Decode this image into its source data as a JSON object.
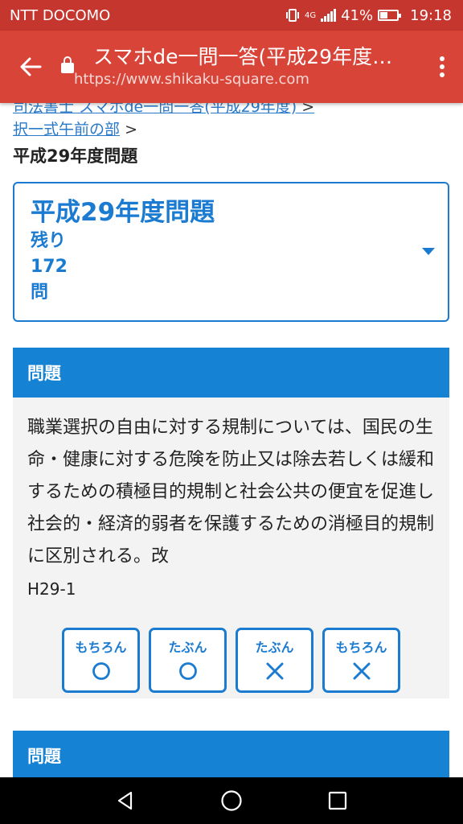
{
  "status_bar": {
    "carrier": "NTT DOCOMO",
    "network": "4G",
    "battery_percent": "41%",
    "battery_level": 0.41,
    "time": "19:18"
  },
  "toolbar": {
    "title": "スマホde一問一答(平成29年度…",
    "url": "https://www.shikaku-square.com"
  },
  "breadcrumb": {
    "partial_link": "司法書士 スマホde一問一答(平成29年度)",
    "partial_sep": ">",
    "link": "択一式午前の部",
    "sep": ">",
    "current": "平成29年度問題"
  },
  "selector": {
    "title": "平成29年度問題",
    "remaining_label": "残り",
    "remaining_count": "172",
    "unit": "問"
  },
  "question1": {
    "header": "問題",
    "text": "職業選択の自由に対する規制については、国民の生命・健康に対する危険を防止又は除去若しくは緩和するための積極目的規制と社会公共の便宜を促進し社会的・経済的弱者を保護するための消極目的規制に区別される。改",
    "code": "H29-1",
    "answers": [
      {
        "label": "もちろん",
        "mark": "circle"
      },
      {
        "label": "たぶん",
        "mark": "circle"
      },
      {
        "label": "たぶん",
        "mark": "cross"
      },
      {
        "label": "もちろん",
        "mark": "cross"
      }
    ]
  },
  "question2": {
    "header": "問題"
  },
  "colors": {
    "status_bar": "#c4362e",
    "toolbar": "#d84438",
    "accent": "#1682d4",
    "link": "#2979c8"
  }
}
